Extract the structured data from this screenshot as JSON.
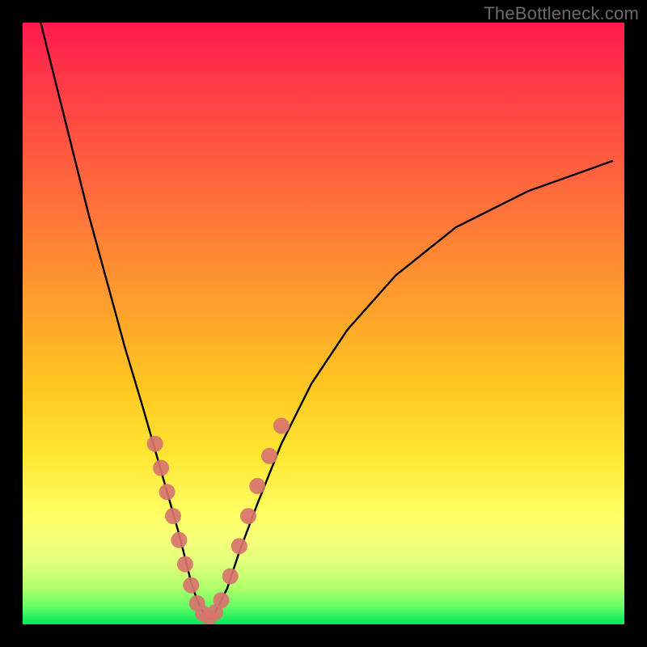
{
  "watermark": {
    "text": "TheBottleneck.com"
  },
  "chart_data": {
    "type": "line",
    "title": "",
    "xlabel": "",
    "ylabel": "",
    "xlim": [
      0,
      100
    ],
    "ylim": [
      0,
      100
    ],
    "grid": false,
    "legend": false,
    "series": [
      {
        "name": "bottleneck-curve",
        "x": [
          3,
          5,
          8,
          11,
          14,
          17,
          20,
          22,
          24,
          26,
          27,
          28,
          29,
          30,
          31,
          32,
          34,
          36,
          39,
          43,
          48,
          54,
          62,
          72,
          84,
          98
        ],
        "y": [
          100,
          92,
          80,
          68,
          57,
          46,
          36,
          29,
          22,
          15,
          11,
          7,
          4,
          2,
          1,
          2,
          6,
          12,
          20,
          30,
          40,
          49,
          58,
          66,
          72,
          77
        ]
      }
    ],
    "markers": [
      {
        "name": "highlight-dots-left",
        "color": "#d7746e",
        "r": 10,
        "points": [
          {
            "x": 22.0,
            "y": 30.0
          },
          {
            "x": 23.0,
            "y": 26.0
          },
          {
            "x": 24.0,
            "y": 22.0
          },
          {
            "x": 25.0,
            "y": 18.0
          },
          {
            "x": 26.0,
            "y": 14.0
          },
          {
            "x": 27.0,
            "y": 10.0
          },
          {
            "x": 28.0,
            "y": 6.5
          },
          {
            "x": 29.0,
            "y": 3.5
          },
          {
            "x": 30.0,
            "y": 1.8
          },
          {
            "x": 31.0,
            "y": 1.2
          }
        ]
      },
      {
        "name": "highlight-dots-right",
        "color": "#d7746e",
        "r": 10,
        "points": [
          {
            "x": 32.0,
            "y": 2.0
          },
          {
            "x": 33.0,
            "y": 4.0
          },
          {
            "x": 34.5,
            "y": 8.0
          },
          {
            "x": 36.0,
            "y": 13.0
          },
          {
            "x": 37.5,
            "y": 18.0
          },
          {
            "x": 39.0,
            "y": 23.0
          },
          {
            "x": 41.0,
            "y": 28.0
          },
          {
            "x": 43.0,
            "y": 33.0
          }
        ]
      }
    ],
    "background_gradient": {
      "direction": "vertical",
      "stops": [
        {
          "pos": 0,
          "color": "#ff1a4d"
        },
        {
          "pos": 50,
          "color": "#ffb030"
        },
        {
          "pos": 80,
          "color": "#ffff55"
        },
        {
          "pos": 100,
          "color": "#00e65a"
        }
      ]
    }
  }
}
